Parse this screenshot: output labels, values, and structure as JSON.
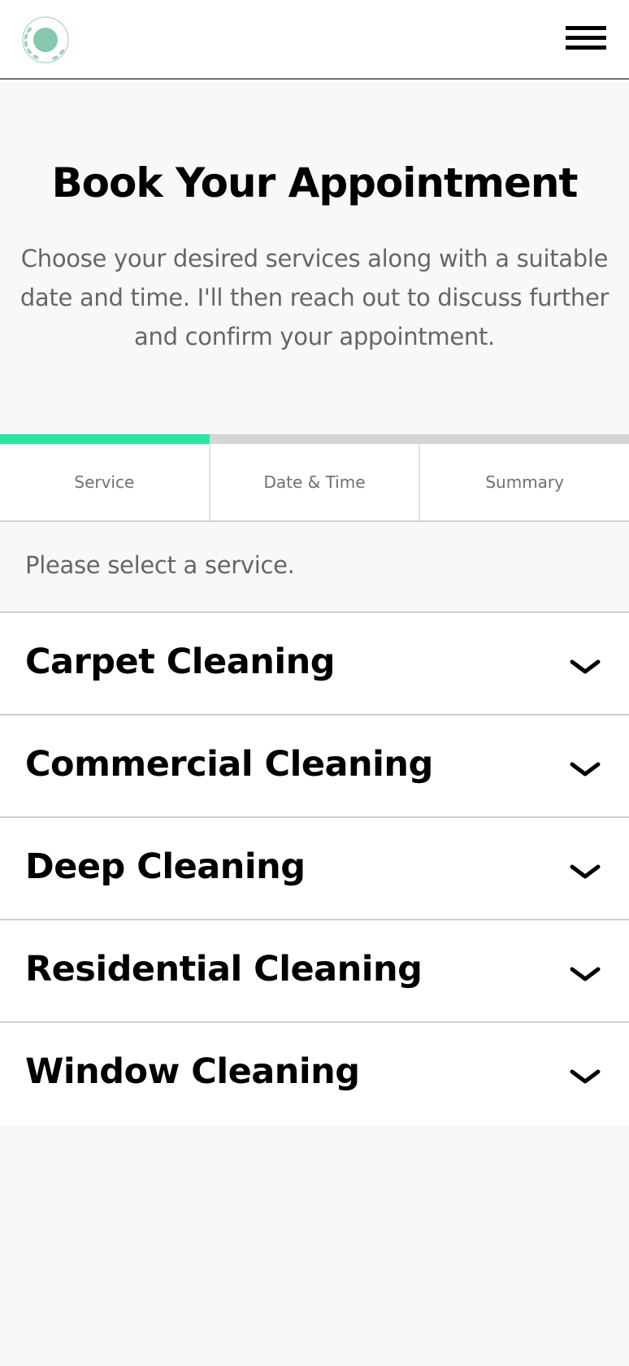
{
  "header": {
    "logo_icon": "wreath-circle-logo",
    "menu_icon": "hamburger-menu-icon"
  },
  "hero": {
    "title": "Book Your Appointment",
    "description": "Choose your desired services along with a suitable date and time. I'll then reach out to discuss further and confirm your appointment."
  },
  "progress": {
    "active_step": 1,
    "total_steps": 3,
    "fraction_complete": 0.333,
    "accent_color": "#26e8a2"
  },
  "steps": [
    {
      "label": "Service"
    },
    {
      "label": "Date & Time"
    },
    {
      "label": "Summary"
    }
  ],
  "prompt": "Please select a service.",
  "services": [
    {
      "name": "Carpet Cleaning",
      "icon": "chevron-down-icon"
    },
    {
      "name": "Commercial Cleaning",
      "icon": "chevron-down-icon"
    },
    {
      "name": "Deep Cleaning",
      "icon": "chevron-down-icon"
    },
    {
      "name": "Residential Cleaning",
      "icon": "chevron-down-icon"
    },
    {
      "name": "Window Cleaning",
      "icon": "chevron-down-icon"
    }
  ]
}
